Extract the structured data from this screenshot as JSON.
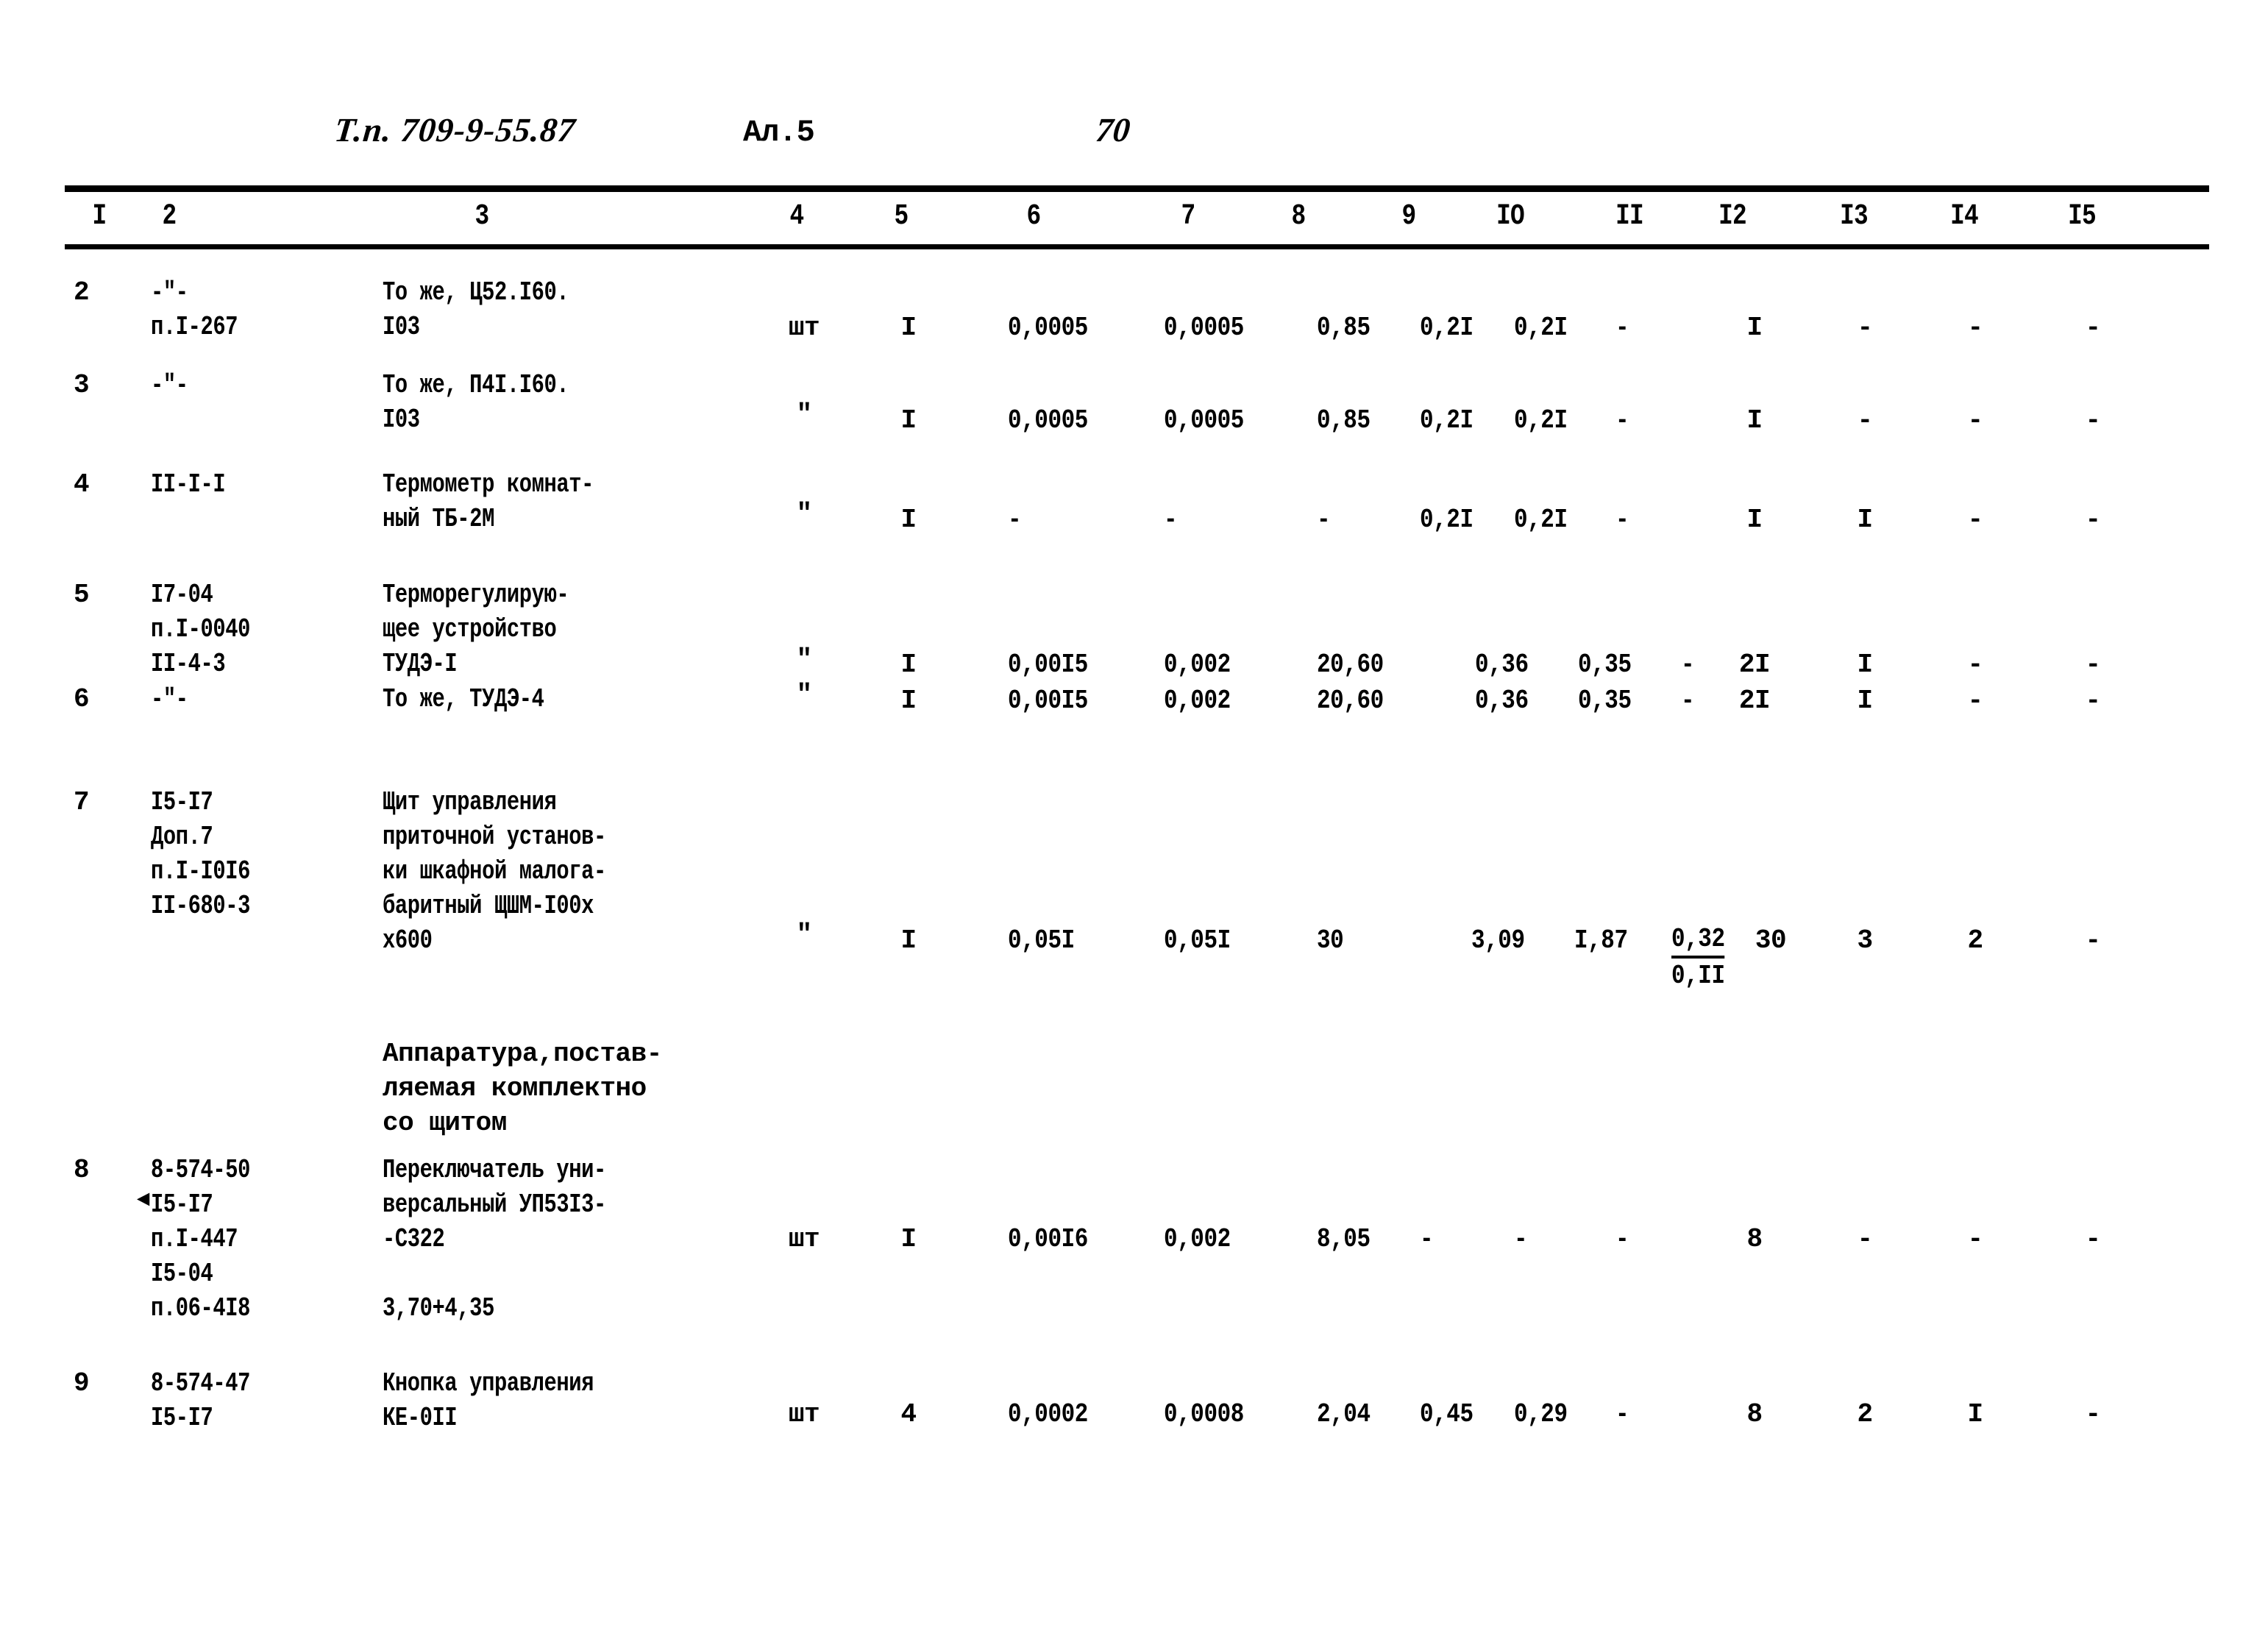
{
  "header": {
    "doc_code": "Т.п. 709-9-55.87",
    "album": "Ал.5",
    "page_number": "70"
  },
  "table": {
    "column_headers": [
      "I",
      "2",
      "3",
      "4",
      "5",
      "6",
      "7",
      "8",
      "9",
      "IO",
      "II",
      "I2",
      "I3",
      "I4",
      "I5"
    ],
    "rows": [
      {
        "pos": "2",
        "code": "-\"-\nп.I-267",
        "name": "То же, Ц52.I60.\nI03",
        "unit": "шт",
        "qty": "I",
        "c6": "0,0005",
        "c7": "0,0005",
        "c8": "0,85",
        "c9": "0,2I",
        "c10": "0,2I",
        "c11": "-",
        "c12": "I",
        "c13": "-",
        "c14": "-",
        "c15": "-"
      },
      {
        "pos": "3",
        "code": "-\"-",
        "name": "То же, П4I.I60.\nI03",
        "unit": "\"",
        "qty": "I",
        "c6": "0,0005",
        "c7": "0,0005",
        "c8": "0,85",
        "c9": "0,2I",
        "c10": "0,2I",
        "c11": "-",
        "c12": "I",
        "c13": "-",
        "c14": "-",
        "c15": "-"
      },
      {
        "pos": "4",
        "code": "II-I-I",
        "name": "Термометр комнат-\nный ТБ-2М",
        "unit": "\"",
        "qty": "I",
        "c6": "-",
        "c7": "-",
        "c8": "-",
        "c9": "0,2I",
        "c10": "0,2I",
        "c11": "-",
        "c12": "I",
        "c13": "I",
        "c14": "-",
        "c15": "-"
      },
      {
        "pos": "5",
        "code": "I7-04\nп.I-0040\nII-4-3",
        "name": "Терморегулирую-\nщее устройство\nТУДЭ-I",
        "unit": "\"",
        "qty": "I",
        "c6": "0,00I5",
        "c7": "0,002",
        "c8": "20,60",
        "c9": "",
        "c10": "0,36",
        "c11": "0,35",
        "c12": "-",
        "c12b": "2I",
        "c13": "I",
        "c14": "-",
        "c15": "-"
      },
      {
        "pos": "6",
        "code": "-\"-",
        "name": "То же, ТУДЭ-4",
        "unit": "\"",
        "qty": "I",
        "c6": "0,00I5",
        "c7": "0,002",
        "c8": "20,60",
        "c9": "",
        "c10": "0,36",
        "c11": "0,35",
        "c12": "-",
        "c12b": "2I",
        "c13": "I",
        "c14": "-",
        "c15": "-"
      },
      {
        "pos": "7",
        "code": "I5-I7\nДоп.7\nп.I-I0I6\nII-680-3",
        "name": "Щит управления\nприточной установ-\nки шкафной малога-\nбаритный ЩШМ-I00х\nх600",
        "unit": "\"",
        "qty": "I",
        "c6": "0,05I",
        "c7": "0,05I",
        "c8": "30",
        "c9": "",
        "c10": "3,09",
        "c11": "I,87",
        "c12_numerator": "0,32",
        "c12_denominator": "0,II",
        "c12b": "30",
        "c13": "3",
        "c14": "2",
        "c15": "-"
      },
      {
        "pos": "8",
        "code": "8-574-50\nI5-I7\nп.I-447\nI5-04\nп.06-4I8",
        "name": "Переключатель уни-\nверсальный УП53I3-\n-С322",
        "name_extra": "3,70+4,35",
        "unit": "шт",
        "qty": "I",
        "c6": "0,00I6",
        "c7": "0,002",
        "c8": "8,05",
        "c9": "-",
        "c10": "-",
        "c11": "-",
        "c12": "8",
        "c13": "-",
        "c14": "-",
        "c15": "-"
      },
      {
        "pos": "9",
        "code": "8-574-47\nI5-I7",
        "name": "Кнопка управления\nКЕ-0II",
        "unit": "шт",
        "qty": "4",
        "c6": "0,0002",
        "c7": "0,0008",
        "c8": "2,04",
        "c9": "0,45",
        "c10": "0,29",
        "c11": "-",
        "c12": "8",
        "c13": "2",
        "c14": "I",
        "c15": "-"
      }
    ],
    "note": "Аппаратура,постав-\nляемая комплектно\nсо щитом"
  }
}
